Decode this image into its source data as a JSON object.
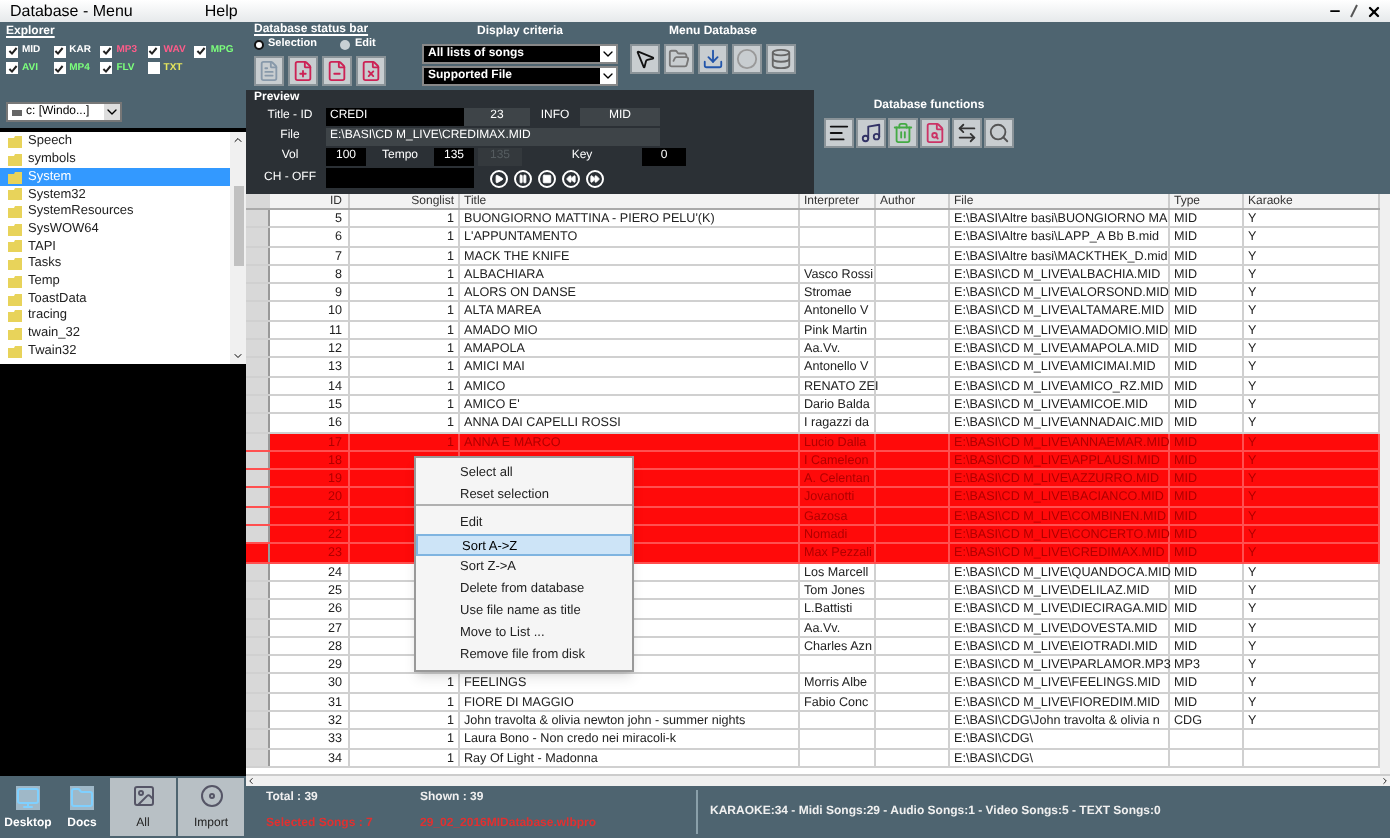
{
  "menu_bar": {
    "items": [
      "Database - Menu",
      "Help"
    ]
  },
  "explorer": {
    "title": "Explorer",
    "filters": [
      {
        "label": "MID",
        "checked": true,
        "color": "#ffffff"
      },
      {
        "label": "KAR",
        "checked": true,
        "color": "#ffffff"
      },
      {
        "label": "MP3",
        "checked": true,
        "color": "#ff5c8a"
      },
      {
        "label": "WAV",
        "checked": true,
        "color": "#ff5c8a"
      },
      {
        "label": "MPG",
        "checked": true,
        "color": "#7cff7c"
      },
      {
        "label": "AVI",
        "checked": true,
        "color": "#7cff7c"
      },
      {
        "label": "MP4",
        "checked": true,
        "color": "#7cff7c"
      },
      {
        "label": "FLV",
        "checked": true,
        "color": "#7cff7c"
      },
      {
        "label": "TXT",
        "checked": false,
        "color": "#e6e65c"
      }
    ],
    "drive": "c: [Windo...]",
    "folders": [
      {
        "label": "Speech",
        "selected": false
      },
      {
        "label": "symbols",
        "selected": false
      },
      {
        "label": "System",
        "selected": true
      },
      {
        "label": "System32",
        "selected": false
      },
      {
        "label": "SystemResources",
        "selected": false
      },
      {
        "label": "SysWOW64",
        "selected": false
      },
      {
        "label": "TAPI",
        "selected": false
      },
      {
        "label": "Tasks",
        "selected": false
      },
      {
        "label": "Temp",
        "selected": false
      },
      {
        "label": "ToastData",
        "selected": false
      },
      {
        "label": "tracing",
        "selected": false
      },
      {
        "label": "twain_32",
        "selected": false
      },
      {
        "label": "Twain32",
        "selected": false
      }
    ],
    "buttons": [
      "Desktop",
      "Docs",
      "All",
      "Import"
    ]
  },
  "status_bar_panel": {
    "title": "Database status bar",
    "modes": [
      {
        "label": "Selection",
        "selected": true
      },
      {
        "label": "Edit",
        "selected": false
      }
    ]
  },
  "display_criteria": {
    "title": "Display criteria",
    "list": "All lists of songs",
    "filter": "Supported File"
  },
  "menu_database": {
    "title": "Menu Database"
  },
  "preview": {
    "title": "Preview",
    "title_label": "Title - ID",
    "song_title": "CREDI",
    "song_id": "23",
    "info_label": "INFO",
    "info": "MID",
    "file_label": "File",
    "file": "E:\\BASI\\CD M_LIVE\\CREDIMAX.MID",
    "vol_label": "Vol",
    "vol": "100",
    "tempo_label": "Tempo",
    "tempo": "135",
    "tempo_original": {
      "value": "135",
      "disabled": true
    },
    "key_label": "Key",
    "key": "0",
    "ch_label": "CH - OFF"
  },
  "database_functions": {
    "title": "Database functions"
  },
  "table": {
    "columns": [
      "ID",
      "Songlist",
      "Title",
      "Interpreter",
      "Author",
      "File",
      "Type",
      "Karaoke"
    ],
    "rows": [
      {
        "id": "5",
        "songlist": "1",
        "title": "BUONGIORNO MATTINA - PIERO PELU'(K)",
        "file": "E:\\BASI\\Altre basi\\BUONGIORNO MA",
        "type": "MID",
        "karaoke": "Y",
        "selected": false
      },
      {
        "id": "6",
        "songlist": "1",
        "title": "L'APPUNTAMENTO",
        "file": "E:\\BASI\\Altre basi\\LAPP_A Bb B.mid",
        "type": "MID",
        "karaoke": "Y",
        "selected": false
      },
      {
        "id": "7",
        "songlist": "1",
        "title": "MACK THE KNIFE",
        "file": "E:\\BASI\\Altre basi\\MACKTHEK_D.mid",
        "type": "MID",
        "karaoke": "Y",
        "selected": false
      },
      {
        "id": "8",
        "songlist": "1",
        "title": "ALBACHIARA",
        "interpreter": "Vasco Rossi",
        "file": "E:\\BASI\\CD M_LIVE\\ALBACHIA.MID",
        "type": "MID",
        "karaoke": "Y",
        "selected": false
      },
      {
        "id": "9",
        "songlist": "1",
        "title": "ALORS ON DANSE",
        "interpreter": "Stromae",
        "file": "E:\\BASI\\CD M_LIVE\\ALORSOND.MID",
        "type": "MID",
        "karaoke": "Y",
        "selected": false
      },
      {
        "id": "10",
        "songlist": "1",
        "title": "ALTA MAREA",
        "interpreter": "Antonello V",
        "file": "E:\\BASI\\CD M_LIVE\\ALTAMARE.MID",
        "type": "MID",
        "karaoke": "Y",
        "selected": false
      },
      {
        "id": "11",
        "songlist": "1",
        "title": "AMADO MIO",
        "interpreter": "Pink Martin",
        "file": "E:\\BASI\\CD M_LIVE\\AMADOMIO.MID",
        "type": "MID",
        "karaoke": "Y",
        "selected": false
      },
      {
        "id": "12",
        "songlist": "1",
        "title": "AMAPOLA",
        "interpreter": "Aa.Vv.",
        "file": "E:\\BASI\\CD M_LIVE\\AMAPOLA.MID",
        "type": "MID",
        "karaoke": "Y",
        "selected": false
      },
      {
        "id": "13",
        "songlist": "1",
        "title": "AMICI MAI",
        "interpreter": "Antonello V",
        "file": "E:\\BASI\\CD M_LIVE\\AMICIMAI.MID",
        "type": "MID",
        "karaoke": "Y",
        "selected": false
      },
      {
        "id": "14",
        "songlist": "1",
        "title": "AMICO",
        "interpreter": "RENATO ZEI",
        "file": "E:\\BASI\\CD M_LIVE\\AMICO_RZ.MID",
        "type": "MID",
        "karaoke": "Y",
        "selected": false
      },
      {
        "id": "15",
        "songlist": "1",
        "title": "AMICO E'",
        "interpreter": "Dario Balda",
        "file": "E:\\BASI\\CD M_LIVE\\AMICOE.MID",
        "type": "MID",
        "karaoke": "Y",
        "selected": false
      },
      {
        "id": "16",
        "songlist": "1",
        "title": "ANNA DAI CAPELLI ROSSI",
        "interpreter": "I ragazzi da",
        "file": "E:\\BASI\\CD M_LIVE\\ANNADAIC.MID",
        "type": "MID",
        "karaoke": "Y",
        "selected": false
      },
      {
        "id": "17",
        "songlist": "1",
        "title": "ANNA E MARCO",
        "interpreter": "Lucio Dalla",
        "file": "E:\\BASI\\CD M_LIVE\\ANNAEMAR.MID",
        "type": "MID",
        "karaoke": "Y",
        "selected": true
      },
      {
        "id": "18",
        "interpreter": "I Cameleon",
        "file": "E:\\BASI\\CD M_LIVE\\APPLAUSI.MID",
        "type": "MID",
        "karaoke": "Y",
        "selected": true
      },
      {
        "id": "19",
        "interpreter": "A. Celentan",
        "file": "E:\\BASI\\CD M_LIVE\\AZZURRO.MID",
        "type": "MID",
        "karaoke": "Y",
        "selected": true
      },
      {
        "id": "20",
        "interpreter": "Jovanotti",
        "file": "E:\\BASI\\CD M_LIVE\\BACIANCO.MID",
        "type": "MID",
        "karaoke": "Y",
        "selected": true
      },
      {
        "id": "21",
        "interpreter": "Gazosa",
        "file": "E:\\BASI\\CD M_LIVE\\COMBINEN.MID",
        "type": "MID",
        "karaoke": "Y",
        "selected": true
      },
      {
        "id": "22",
        "interpreter": "Nomadi",
        "file": "E:\\BASI\\CD M_LIVE\\CONCERTO.MID",
        "type": "MID",
        "karaoke": "Y",
        "selected": true
      },
      {
        "id": "23",
        "interpreter": "Max Pezzali",
        "file": "E:\\BASI\\CD M_LIVE\\CREDIMAX.MID",
        "type": "MID",
        "karaoke": "Y",
        "selected": true
      },
      {
        "id": "24",
        "interpreter": "Los Marcell",
        "file": "E:\\BASI\\CD M_LIVE\\QUANDOCA.MID",
        "type": "MID",
        "karaoke": "Y",
        "selected": false
      },
      {
        "id": "25",
        "interpreter": "Tom Jones",
        "file": "E:\\BASI\\CD M_LIVE\\DELILAZ.MID",
        "type": "MID",
        "karaoke": "Y",
        "selected": false
      },
      {
        "id": "26",
        "interpreter": "L.Battisti",
        "file": "E:\\BASI\\CD M_LIVE\\DIECIRAGA.MID",
        "type": "MID",
        "karaoke": "Y",
        "selected": false
      },
      {
        "id": "27",
        "interpreter": "Aa.Vv.",
        "file": "E:\\BASI\\CD M_LIVE\\DOVESTA.MID",
        "type": "MID",
        "karaoke": "Y",
        "selected": false
      },
      {
        "id": "28",
        "interpreter": "Charles Azn",
        "file": "E:\\BASI\\CD M_LIVE\\EIOTRADI.MID",
        "type": "MID",
        "karaoke": "Y",
        "selected": false
      },
      {
        "id": "29",
        "file": "E:\\BASI\\CD M_LIVE\\PARLAMOR.MP3",
        "type": "MP3",
        "karaoke": "Y",
        "selected": false
      },
      {
        "id": "30",
        "songlist": "1",
        "title": "FEELINGS",
        "interpreter": "Morris Albe",
        "file": "E:\\BASI\\CD M_LIVE\\FEELINGS.MID",
        "type": "MID",
        "karaoke": "Y",
        "selected": false
      },
      {
        "id": "31",
        "songlist": "1",
        "title": "FIORE DI MAGGIO",
        "interpreter": "Fabio Conc",
        "file": "E:\\BASI\\CD M_LIVE\\FIOREDIM.MID",
        "type": "MID",
        "karaoke": "Y",
        "selected": false
      },
      {
        "id": "32",
        "songlist": "1",
        "title": "John travolta & olivia newton john - summer nights",
        "file": "E:\\BASI\\CDG\\John travolta & olivia n",
        "type": "CDG",
        "karaoke": "Y",
        "selected": false
      },
      {
        "id": "33",
        "songlist": "1",
        "title": "Laura Bono - Non credo nei miracoli-k",
        "file": "E:\\BASI\\CDG\\",
        "selected": false
      },
      {
        "id": "34",
        "songlist": "1",
        "title": "Ray Of Light - Madonna",
        "file": "E:\\BASI\\CDG\\",
        "selected": false
      }
    ]
  },
  "context_menu": {
    "items": [
      {
        "label": "Select all",
        "selected": false,
        "separator_after": false
      },
      {
        "label": "Reset selection",
        "selected": false,
        "separator_after": true
      },
      {
        "label": "Edit",
        "selected": false,
        "separator_after": false
      },
      {
        "label": "Sort A->Z",
        "selected": true,
        "separator_after": false
      },
      {
        "label": "Sort Z->A",
        "selected": false,
        "separator_after": false
      },
      {
        "label": "Delete from database",
        "selected": false,
        "separator_after": false
      },
      {
        "label": "Use file name as title",
        "selected": false,
        "separator_after": false
      },
      {
        "label": "Move to List ...",
        "selected": false,
        "separator_after": false
      },
      {
        "label": "Remove file from disk",
        "selected": false,
        "separator_after": false
      }
    ]
  },
  "status_bar": {
    "total": "Total : 39",
    "selected_songs": "Selected Songs : 7",
    "shown": "Shown : 39",
    "database_file": "29_02_2016MIDatabase.wlbpro",
    "summary": "KARAOKE:34 - Midi Songs:29 - Audio Songs:1 - Video Songs:5 - TEXT Songs:0"
  }
}
